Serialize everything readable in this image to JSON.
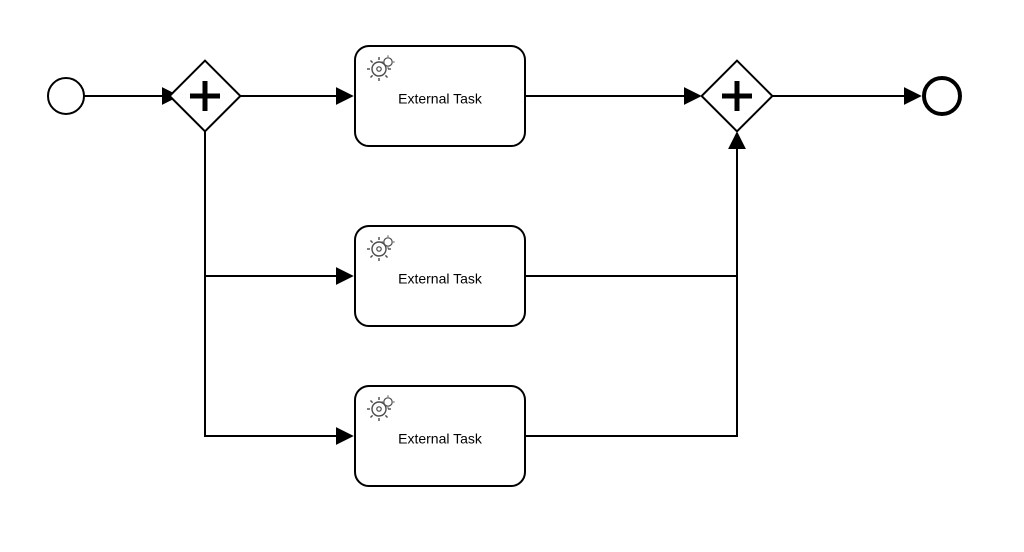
{
  "diagram": {
    "type": "BPMN",
    "start_event": {
      "kind": "none-start"
    },
    "end_event": {
      "kind": "none-end"
    },
    "gateways": {
      "split": {
        "type": "parallel",
        "symbol": "+"
      },
      "join": {
        "type": "parallel",
        "symbol": "+"
      }
    },
    "tasks": [
      {
        "label": "External Task",
        "type": "service"
      },
      {
        "label": "External Task",
        "type": "service"
      },
      {
        "label": "External Task",
        "type": "service"
      }
    ]
  }
}
